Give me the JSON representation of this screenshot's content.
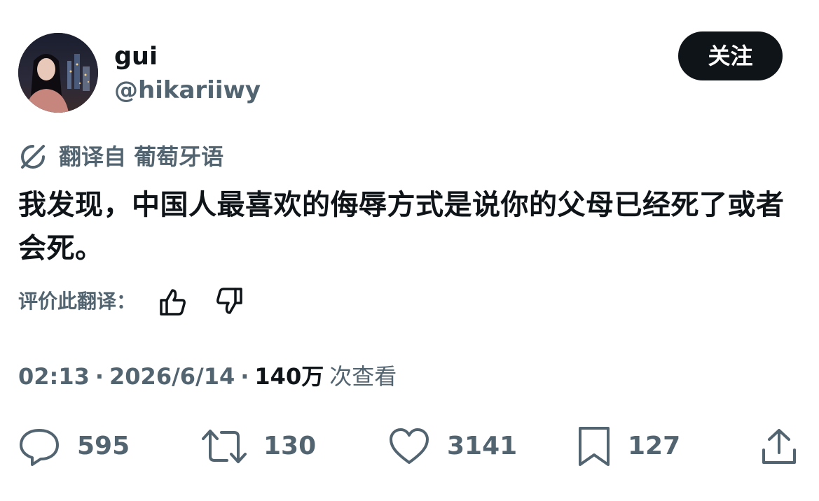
{
  "author": {
    "display_name": "gui",
    "handle": "@hikariiwy",
    "follow_label": "关注"
  },
  "translation": {
    "label": "翻译自 葡萄牙语",
    "rate_label": "评价此翻译："
  },
  "tweet": {
    "text": "我发现，中国人最喜欢的侮辱方式是说你的父母已经死了或者会死。"
  },
  "meta": {
    "time": "02:13",
    "separator": "·",
    "date": "2026/6/14",
    "views_count": "140万",
    "views_label": "次查看"
  },
  "actions": {
    "replies": "595",
    "reposts": "130",
    "likes": "3141",
    "bookmarks": "127"
  },
  "icons": {
    "translate": "translate-icon",
    "thumbs_up": "thumbs-up-icon",
    "thumbs_down": "thumbs-down-icon",
    "reply": "reply-icon",
    "repost": "repost-icon",
    "like": "heart-icon",
    "bookmark": "bookmark-icon",
    "share": "share-icon"
  },
  "colors": {
    "text_primary": "#0f1419",
    "text_secondary": "#536471",
    "button_bg": "#0f1419",
    "button_text": "#ffffff"
  }
}
